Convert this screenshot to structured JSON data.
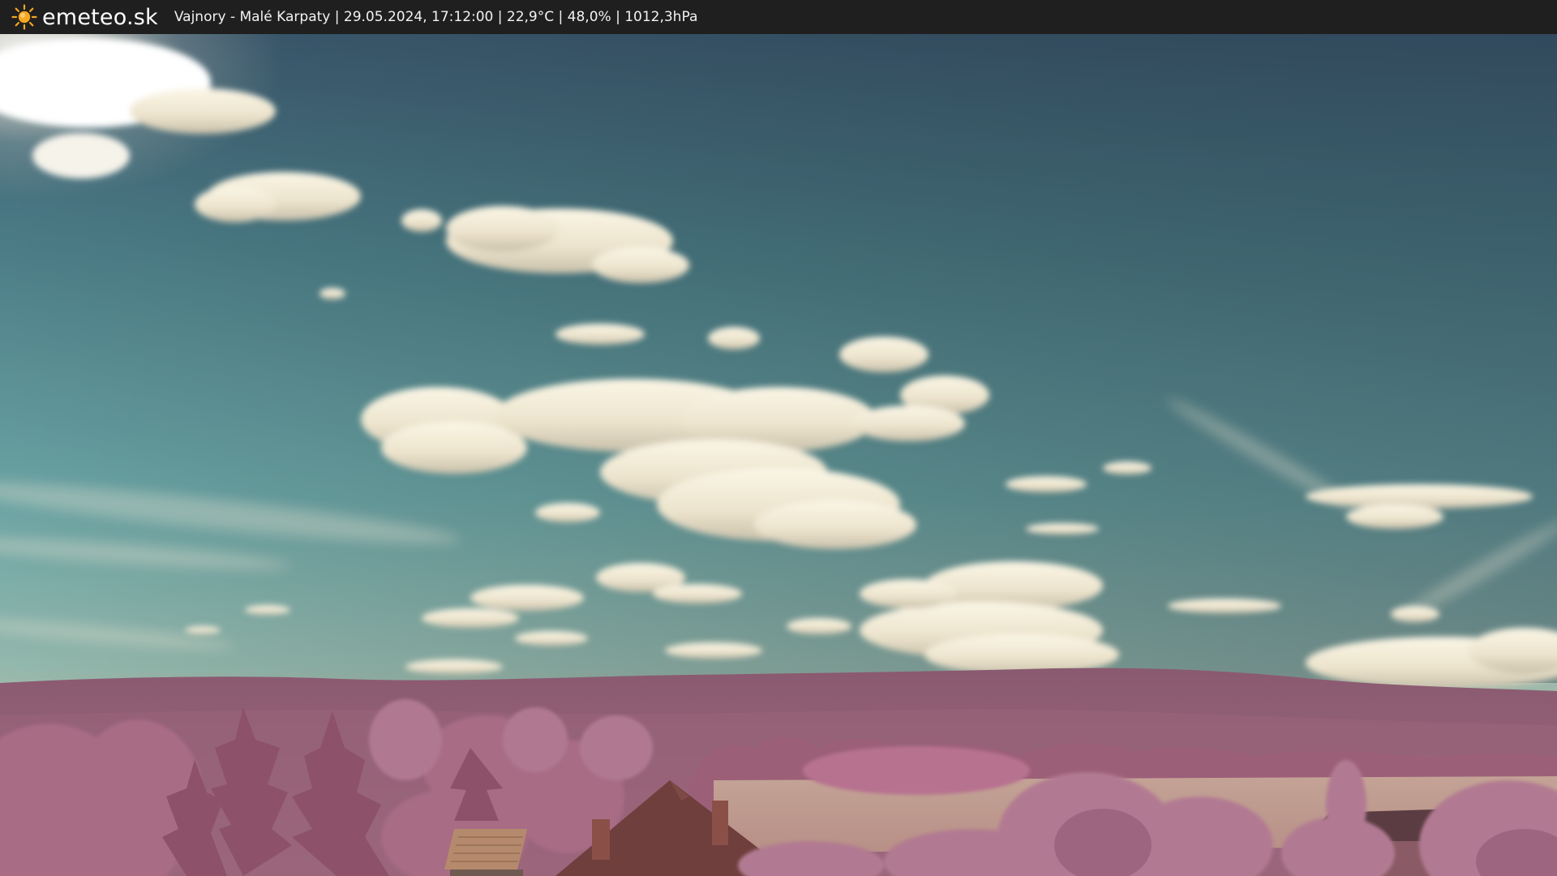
{
  "header": {
    "brand": "emeteo.sk",
    "brand_icon": "sun-icon",
    "caption": "Vajnory - Malé Karpaty | 29.05.2024, 17:12:00 | 22,9°C | 48,0% | 1012,3hPa"
  },
  "colors": {
    "bar": "#1f1f1f",
    "sun": "#f5a623",
    "sky_top": "#3e5f73",
    "sky_mid": "#5f9aa0",
    "sky_horizon": "#c9b9a0",
    "hills": "#8e5a72",
    "foliage": "#b37b93",
    "field": "#c5a59a"
  }
}
